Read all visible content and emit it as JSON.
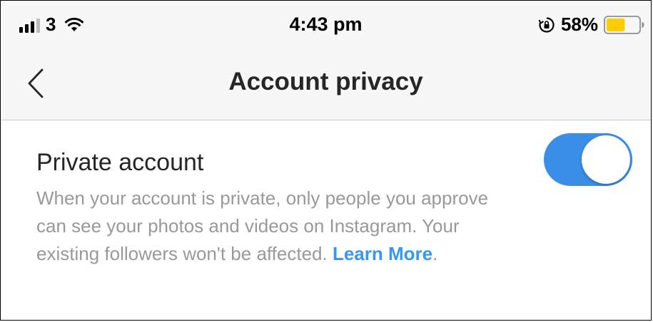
{
  "status_bar": {
    "carrier": "3",
    "time": "4:43 pm",
    "battery_percent": "58%",
    "battery_level": 0.58,
    "battery_color": "#ffcc00"
  },
  "nav": {
    "title": "Account privacy",
    "back_icon": "chevron-left-icon"
  },
  "private_account": {
    "title": "Private account",
    "enabled": true,
    "toggle_color": "#3b8ee8",
    "description": "When your account is private, only people you approve can see your photos and videos on Instagram. Your existing followers won't be affected.",
    "learn_more": "Learn More",
    "learn_more_color": "#3897f0",
    "trailing": "."
  }
}
